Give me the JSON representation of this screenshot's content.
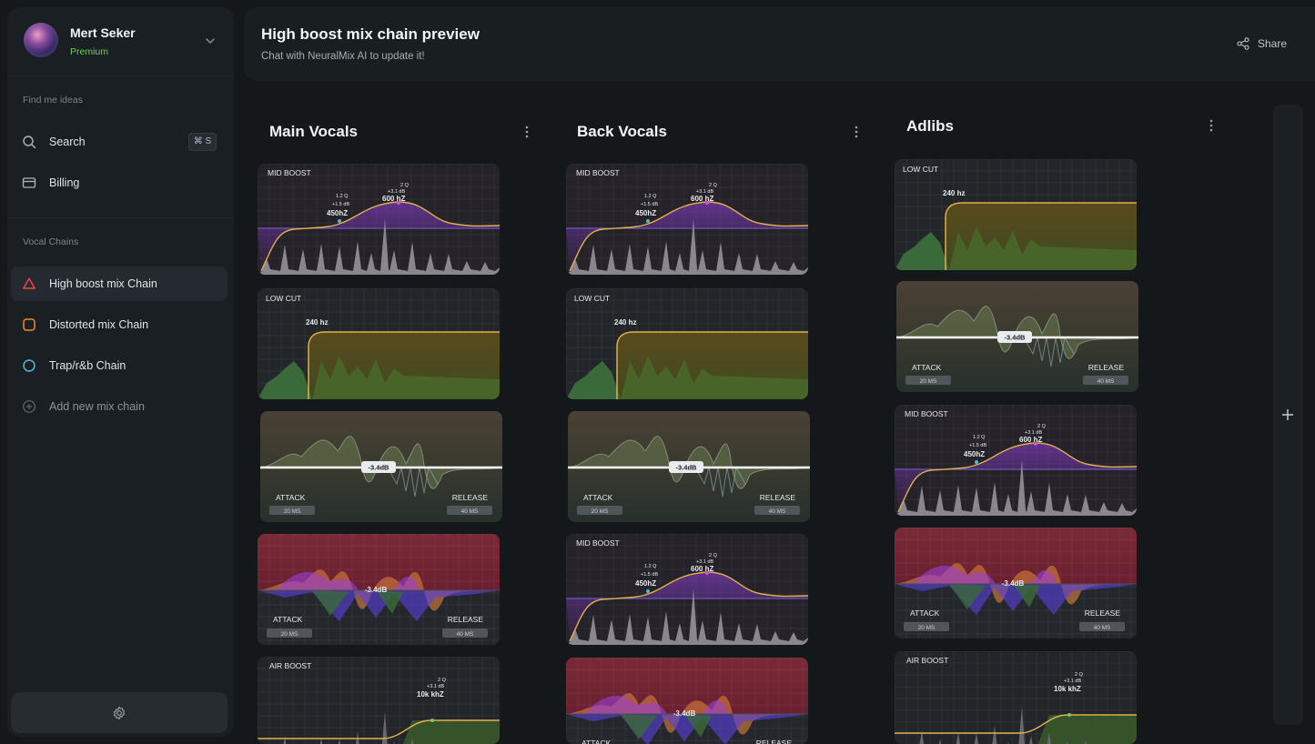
{
  "user": {
    "name": "Mert Seker",
    "plan": "Premium",
    "avatar_icon": "avatar-orb"
  },
  "sidebar": {
    "ideas_label": "Find me ideas",
    "search": {
      "label": "Search",
      "shortcut": "⌘ S"
    },
    "billing": {
      "label": "Billing"
    },
    "chains_label": "Vocal Chains",
    "chains": [
      {
        "label": "High boost mix Chain",
        "icon": "triangle-icon",
        "color": "#e8474b",
        "active": true
      },
      {
        "label": "Distorted mix Chain",
        "icon": "square-icon",
        "color": "#f08a2a",
        "active": false
      },
      {
        "label": "Trap/r&b Chain",
        "icon": "circle-icon",
        "color": "#4fb8d8",
        "active": false
      }
    ],
    "add_label": "Add new mix chain"
  },
  "header": {
    "title": "High boost mix chain preview",
    "subtitle": "Chat with NeuralMix AI to update it!",
    "share_label": "Share"
  },
  "columns": [
    {
      "title": "Main Vocals"
    },
    {
      "title": "Back Vocals"
    },
    {
      "title": "Adlibs"
    }
  ],
  "cards": {
    "mid_boost": {
      "label": "MID BOOST",
      "q1": "1.2 Q",
      "db1": "+1.5 dB",
      "f1": "450hZ",
      "q2": "2 Q",
      "db2": "+3.1 dB",
      "f2": "600 hZ"
    },
    "low_cut": {
      "label": "LOW CUT",
      "freq": "240 hz"
    },
    "compressor": {
      "threshold": "-3.4dB",
      "attack": "ATTACK",
      "attack_val": "20 MS",
      "release": "RELEASE",
      "release_val": "40 MS"
    },
    "air_boost": {
      "label": "AIR BOOST",
      "q": "2 Q",
      "db": "+3.1 dB",
      "freq": "10k khZ"
    }
  },
  "colors": {
    "accent_green": "#6fcf5a",
    "eq_curve": "#e0b04a",
    "purple": "#8a3fd0"
  }
}
